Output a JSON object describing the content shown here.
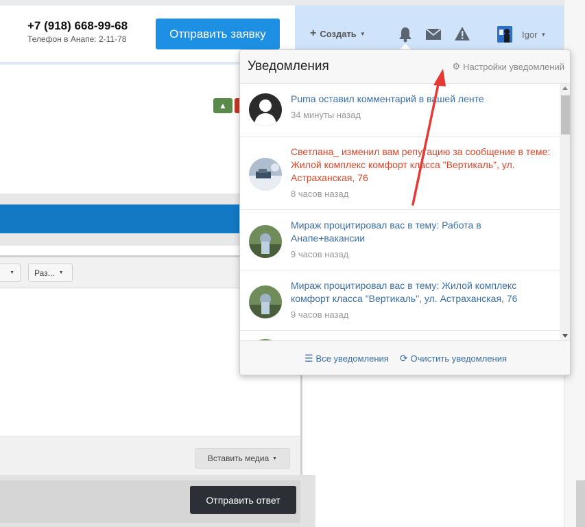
{
  "header": {
    "phone": "+7 (918) 668-99-68",
    "phone_sub": "Телефон в Анапе: 2-11-78",
    "request_button": "Отправить заявку",
    "create_label": "Создать",
    "user_name": "Igor"
  },
  "notifications": {
    "title": "Уведомления",
    "settings_label": "Настройки уведомлений",
    "items": [
      {
        "text": "Puma оставил комментарий в вашей ленте",
        "time": "34 минуты назад",
        "highlight": false
      },
      {
        "text": "Светлана_ изменил вам репутацию за сообщение в теме: Жилой комплекс комфорт класса \"Вертикаль\", ул. Астраханская, 76",
        "time": "8 часов назад",
        "highlight": true
      },
      {
        "text": "Мираж процитировал вас в тему: Работа в Анапе+вакансии",
        "time": "9 часов назад",
        "highlight": false
      },
      {
        "text": "Мираж процитировал вас в тему: Жилой комплекс комфорт класса \"Вертикаль\", ул. Астраханская, 76",
        "time": "9 часов назад",
        "highlight": false
      }
    ],
    "all_label": "Все уведомления",
    "clear_label": "Очистить уведомления"
  },
  "editor": {
    "toolbar_button_2": "Раз...",
    "insert_media": "Вставить медиа",
    "submit_reply": "Отправить ответ"
  },
  "colors": {
    "primary_blue": "#1e90e4",
    "link_blue": "#3a6ea5",
    "alert_red": "#d9472b",
    "annotation_arrow": "#e53935"
  }
}
